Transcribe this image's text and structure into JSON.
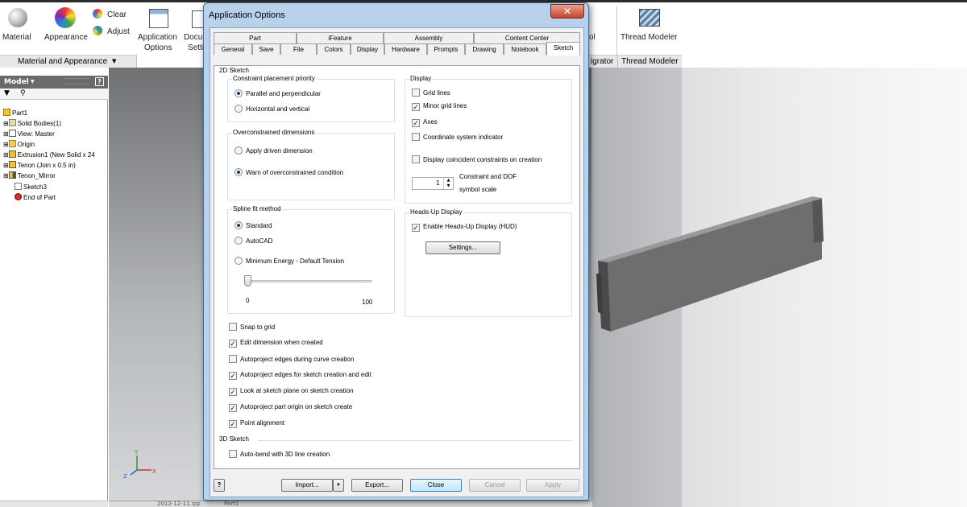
{
  "ribbon": {
    "material_label": "Material",
    "appearance_label": "Appearance",
    "clear_label": "Clear",
    "adjust_label": "Adjust",
    "app_options_label_1": "Application",
    "app_options_label_2": "Options",
    "doc_settings_label_1": "Docu",
    "doc_settings_label_2": "Setti",
    "ol_label": "ol",
    "thread_modeler_label": "Thread Modeler",
    "panel_material_appearance": "Material and Appearance",
    "panel_igrator": "igrator",
    "panel_thread_modeler": "Thread Modeler"
  },
  "browser": {
    "title": "Model",
    "help": "?",
    "items": [
      {
        "label": "Part1"
      },
      {
        "label": "Solid Bodies(1)"
      },
      {
        "label": "View: Master"
      },
      {
        "label": "Origin"
      },
      {
        "label": "Extrusion1 (New Solid x 24"
      },
      {
        "label": "Tenon (Join x 0.5 in)"
      },
      {
        "label": "Tenon_Mirror"
      },
      {
        "label": "Sketch3"
      },
      {
        "label": "End of Part"
      }
    ]
  },
  "status": {
    "date_tab": "2012-12-11.ipp",
    "part_tab": "Part1"
  },
  "dialog": {
    "title": "Application Options",
    "close": "✕",
    "tabs_row1": [
      "Part",
      "iFeature",
      "Assembly",
      "Content Center"
    ],
    "tabs_row2": [
      "General",
      "Save",
      "File",
      "Colors",
      "Display",
      "Hardware",
      "Prompts",
      "Drawing",
      "Notebook",
      "Sketch"
    ],
    "sketch_2d_title": "2D Sketch",
    "constraint_group": "Constraint placement priority",
    "constraint_opt1": "Parallel and perpendicular",
    "constraint_opt2": "Horizontal and vertical",
    "overconstrained_group": "Overconstrained dimensions",
    "over_opt1": "Apply driven dimension",
    "over_opt2": "Warn of overconstrained condition",
    "spline_group": "Spline fit method",
    "spline_opt1": "Standard",
    "spline_opt2": "AutoCAD",
    "spline_opt3": "Minimum Energy - Default Tension",
    "slider_min": "0",
    "slider_max": "100",
    "slider_value": 0,
    "display_group": "Display",
    "disp_grid": "Grid lines",
    "disp_minor": "Minor grid lines",
    "disp_axes": "Axes",
    "disp_coord": "Coordinate system indicator",
    "disp_coincident": "Display coincident constraints on creation",
    "dof_value": "1",
    "dof_label_1": "Constraint and DOF",
    "dof_label_2": "symbol scale",
    "hud_group": "Heads-Up Display",
    "hud_enable": "Enable Heads-Up Display (HUD)",
    "hud_settings": "Settings...",
    "snap_grid": "Snap to grid",
    "edit_dim": "Edit dimension when created",
    "autoproj_curve": "Autoproject edges during curve creation",
    "autoproj_sketch": "Autoproject edges for sketch creation and edit",
    "look_at": "Look at sketch plane on sketch creation",
    "autoproj_origin": "Autoproject part origin on sketch create",
    "point_align": "Point alignment",
    "sketch_3d_title": "3D Sketch",
    "auto_bend": "Auto-bend with 3D line creation",
    "help": "?",
    "import": "Import...",
    "import_arrow": "▼",
    "export": "Export...",
    "close_btn": "Close",
    "cancel": "Cancel",
    "apply": "Apply"
  },
  "axes": {
    "x": "X",
    "y": "Y",
    "z": "Z"
  }
}
